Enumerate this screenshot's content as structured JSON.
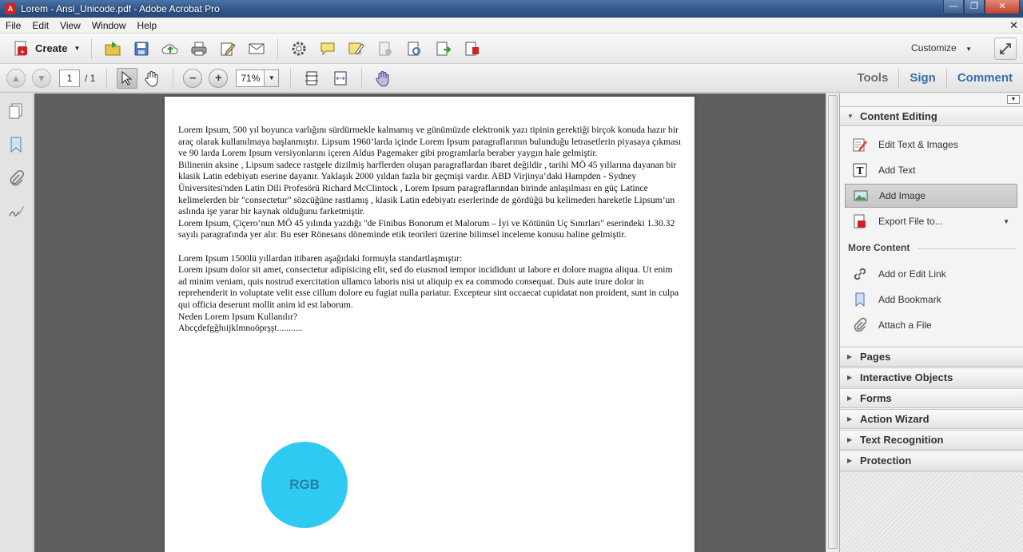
{
  "window": {
    "title": "Lorem - Ansi_Unicode.pdf - Adobe Acrobat Pro"
  },
  "menu": [
    "File",
    "Edit",
    "View",
    "Window",
    "Help"
  ],
  "toolbar": {
    "create_label": "Create",
    "customize_label": "Customize"
  },
  "nav": {
    "current_page": "1",
    "total_pages": "/ 1",
    "zoom": "71%"
  },
  "panel_tabs": {
    "tools": "Tools",
    "sign": "Sign",
    "comment": "Comment"
  },
  "content_editing": {
    "title": "Content Editing",
    "items": [
      {
        "label": "Edit Text & Images",
        "icon": "edit-text-images-icon"
      },
      {
        "label": "Add Text",
        "icon": "add-text-icon"
      },
      {
        "label": "Add Image",
        "icon": "add-image-icon",
        "selected": true
      },
      {
        "label": "Export File to...",
        "icon": "export-file-icon"
      }
    ],
    "more_title": "More Content",
    "more_items": [
      {
        "label": "Add or Edit Link",
        "icon": "link-icon"
      },
      {
        "label": "Add Bookmark",
        "icon": "bookmark-icon"
      },
      {
        "label": "Attach a File",
        "icon": "paperclip-icon"
      }
    ]
  },
  "collapsed_sections": [
    "Pages",
    "Interactive Objects",
    "Forms",
    "Action Wizard",
    "Text Recognition",
    "Protection"
  ],
  "document": {
    "paragraphs": [
      "Lorem Ipsum, 500 yıl boyunca varlığını sürdürmekle kalmamış ve günümüzde elektronik yazı tipinin gerektiği birçok konuda hazır bir araç olarak kullanılmaya başlanmıştır. Lipsum 1960’larda içinde Lorem Ipsum paragraflarının bulunduğu letrasetlerin piyasaya çıkması ve 90 larda Lorem Ipsum versiyonlarını içeren Aldus Pagemaker gibi programlarla beraber yaygın hale gelmiştir.",
      "Bilinenin aksine , Lipsum sadece rastgele dizilmiş harflerden oluşan paragraflardan ibaret değildir , tarihi MÖ 45 yıllarına dayanan bir klasik Latin edebiyatı eserine dayanır. Yaklaşık 2000 yıldan fazla bir geçmişi vardır. ABD Virjinya’daki Hampden - Sydney Üniversitesi'nden Latin Dili Profesörü Richard McClintock , Lorem Ipsum paragraflarından birinde anlaşılması en güç Latince kelimelerden bir \"consectetur\" sözcüğüne rastlamış , klasik Latin edebiyatı eserlerinde de gördüğü bu kelimeden hareketle Lipsum’un aslında işe yarar bir kaynak olduğunu farketmiştir.",
      "Lorem Ipsum, Çiçero’nun MÖ 45 yılında yazdığı \"de Finibus Bonorum et Malorum – İyi ve Kötünün Uç Sınırları\" eserindeki 1.30.32 sayılı paragrafında yer alır. Bu eser Rönesans döneminde etik teorileri üzerine bilimsel inceleme konusu haline gelmiştir.",
      "",
      "Lorem Ipsum 1500lü yıllardan itibaren aşağıdaki formuyla standartlaşmıştır:",
      "Lorem ipsum dolor sit amet, consectetur adipisicing elit, sed do eiusmod tempor incididunt ut labore et dolore magna aliqua. Ut enim ad minim veniam, quis nostrud exercitation ullamco laboris nisi ut aliquip ex ea commodo consequat. Duis aute irure dolor in reprehenderit in voluptate velit esse cillum dolore eu fugiat nulla pariatur. Excepteur sint occaecat cupidatat non proident, sunt in culpa qui officia deserunt mollit anim id est laborum.",
      "Neden Lorem Ipsum Kullanılır?",
      "Abcçdefgğhıijklmnoöprşşt..........."
    ],
    "image_label": "RGB",
    "image_color": "#2fcaf2"
  },
  "colors": {
    "titlebar": "#2f5587",
    "accent_blue": "#3a6ea8",
    "doc_bg": "#5e5e5e"
  }
}
